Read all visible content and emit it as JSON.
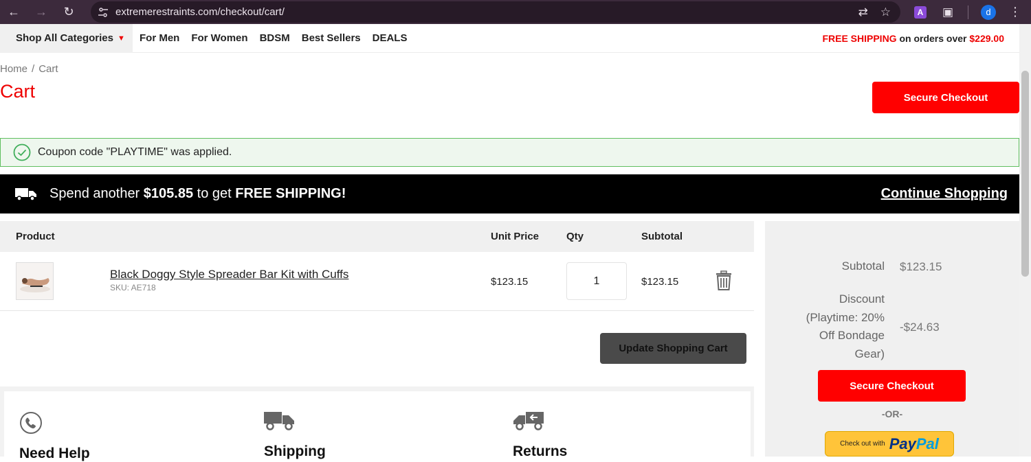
{
  "browser": {
    "url": "extremerestraints.com/checkout/cart/",
    "extension_letter": "A",
    "profile_initial": "d"
  },
  "header": {
    "categories_label": "Shop All Categories",
    "nav_links": [
      "For Men",
      "For Women",
      "BDSM",
      "Best Sellers",
      "DEALS"
    ],
    "promo_highlight": "FREE SHIPPING",
    "promo_middle": " on orders over ",
    "promo_amount": "$229.00"
  },
  "breadcrumb": {
    "home": "Home",
    "separator": "/",
    "current": "Cart"
  },
  "page_title": "Cart",
  "secure_checkout_label": "Secure Checkout",
  "coupon_message": "Coupon code \"PLAYTIME\" was applied.",
  "shipping_banner": {
    "prefix": "Spend another ",
    "amount": "$105.85",
    "middle": " to get ",
    "suffix": "FREE SHIPPING!",
    "continue_label": "Continue Shopping"
  },
  "cart_table": {
    "headers": {
      "product": "Product",
      "unit_price": "Unit Price",
      "qty": "Qty",
      "subtotal": "Subtotal"
    },
    "items": [
      {
        "name": "Black Doggy Style Spreader Bar Kit with Cuffs",
        "sku": "SKU: AE718",
        "unit_price": "$123.15",
        "qty": "1",
        "subtotal": "$123.15"
      }
    ],
    "update_label": "Update Shopping Cart"
  },
  "help": {
    "items": [
      {
        "title": "Need Help",
        "icon": "phone-icon"
      },
      {
        "title": "Shipping",
        "icon": "truck-icon"
      },
      {
        "title": "Returns",
        "icon": "return-truck-icon"
      }
    ]
  },
  "summary": {
    "subtotal_label": "Subtotal",
    "subtotal_value": "$123.15",
    "discount_label": "Discount (Playtime: 20% Off Bondage Gear)",
    "discount_value": "-$24.63",
    "or_label": "-OR-",
    "paypal_small": "Check out with",
    "paypal_word_1": "Pay",
    "paypal_word_2": "Pal"
  },
  "colors": {
    "accent_red": "#ff0000",
    "success_green": "#5fbf5f",
    "banner_black": "#000000"
  }
}
